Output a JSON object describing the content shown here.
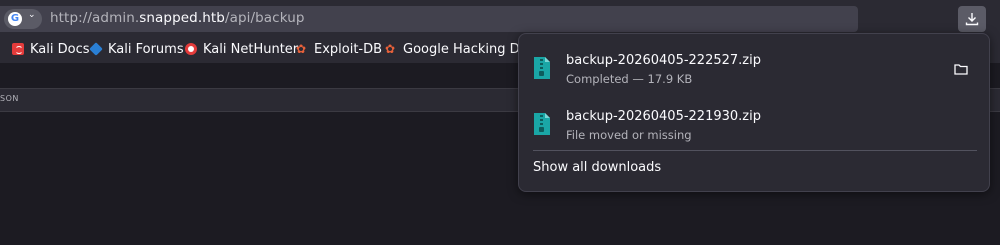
{
  "toolbar": {
    "site_identity_icon": "google-g-icon",
    "site_identity_letter": "G",
    "url_scheme": "http://admin.",
    "url_host": "snapped.htb",
    "url_path": "/api/backup",
    "download_icon": "download-arrow-icon"
  },
  "bookmarks": [
    {
      "label": "Kali Docs",
      "icon": "kali-docs-icon"
    },
    {
      "label": "Kali Forums",
      "icon": "kali-forums-icon"
    },
    {
      "label": "Kali NetHunter",
      "icon": "nethunter-icon"
    },
    {
      "label": "Exploit-DB",
      "icon": "exploit-db-icon"
    },
    {
      "label": "Google Hacking DB",
      "icon": "exploit-db-icon"
    }
  ],
  "page": {
    "tab_fragment": "SON"
  },
  "downloads_panel": {
    "items": [
      {
        "filename": "backup-20260405-222527.zip",
        "status": "Completed — 17.9 KB",
        "icon": "zip-file-icon",
        "action_icon": "folder-icon"
      },
      {
        "filename": "backup-20260405-221930.zip",
        "status": "File moved or missing",
        "icon": "zip-file-icon"
      }
    ],
    "show_all_label": "Show all downloads"
  },
  "colors": {
    "toolbar_bg": "#2b2a33",
    "urlbar_bg": "#42414d",
    "page_bg": "#1c1b22",
    "zip_icon": "#1aa6a6"
  }
}
